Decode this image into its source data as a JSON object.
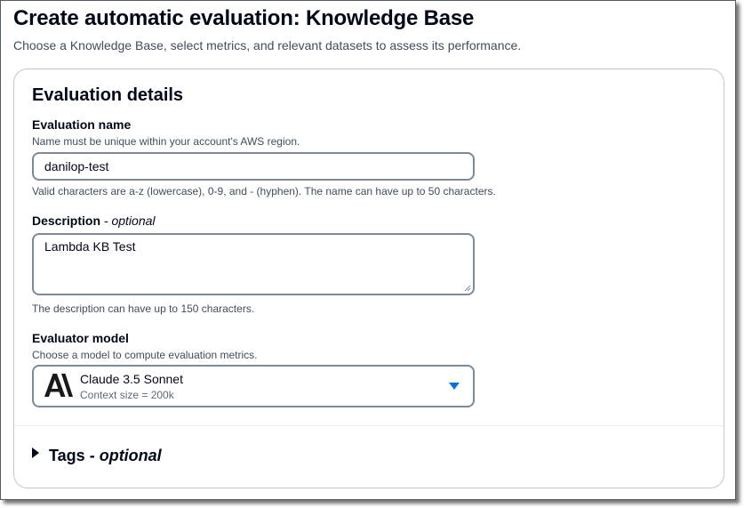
{
  "header": {
    "title": "Create automatic evaluation: Knowledge Base",
    "subtitle": "Choose a Knowledge Base, select metrics, and relevant datasets to assess its performance."
  },
  "panel": {
    "title": "Evaluation details",
    "evaluation_name": {
      "label": "Evaluation name",
      "description": "Name must be unique within your account's AWS region.",
      "value": "danilop-test",
      "constraint": "Valid characters are a-z (lowercase), 0-9, and - (hyphen). The name can have up to 50 characters."
    },
    "description": {
      "label": "Description",
      "optional_suffix": "- optional",
      "value": "Lambda KB Test",
      "constraint": "The description can have up to 150 characters."
    },
    "evaluator_model": {
      "label": "Evaluator model",
      "description": "Choose a model to compute evaluation metrics.",
      "selected_model": "Claude 3.5 Sonnet",
      "selected_context": "Context size = 200k",
      "logo_icon": "anthropic-logo-icon",
      "dropdown_icon": "caret-down-icon"
    },
    "tags": {
      "label": "Tags",
      "optional_suffix": "- optional",
      "expand_icon": "caret-right-icon"
    }
  },
  "colors": {
    "text": "#000716",
    "secondary_text": "#414d5c",
    "input_border": "#7d8998",
    "accent": "#0972d3",
    "panel_border": "#c6c6cd"
  }
}
